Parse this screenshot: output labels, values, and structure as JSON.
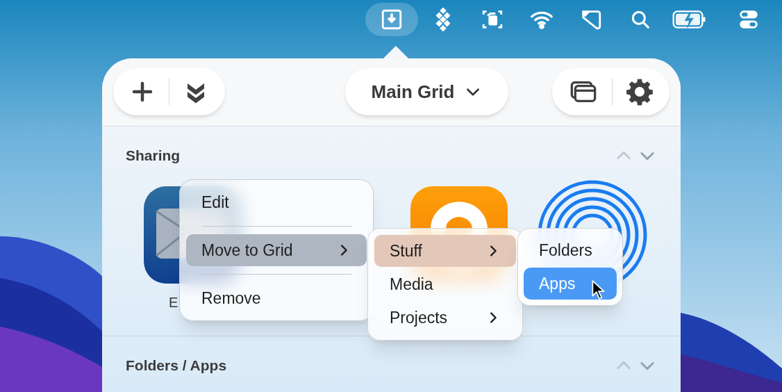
{
  "menu_bar": [
    {
      "kind": "download",
      "selected": true
    },
    {
      "kind": "diamonds",
      "selected": false
    },
    {
      "kind": "capture",
      "selected": false
    },
    {
      "kind": "wifi",
      "selected": false
    },
    {
      "kind": "shape",
      "selected": false
    },
    {
      "kind": "search",
      "selected": false
    },
    {
      "kind": "battery",
      "selected": false
    },
    {
      "kind": "toggles",
      "selected": false
    }
  ],
  "toolbar": {
    "grid_title": "Main Grid"
  },
  "sections": [
    {
      "title": "Sharing",
      "apps": [
        {
          "kind": "mail",
          "label": "E"
        },
        {
          "kind": "hidden"
        },
        {
          "kind": "orange"
        },
        {
          "kind": "rings"
        }
      ]
    },
    {
      "title": "Folders / Apps"
    }
  ],
  "context_menu": [
    {
      "label": "Edit",
      "submenu": false,
      "selected": false
    },
    {
      "label": "Move to Grid",
      "submenu": true,
      "selected": true
    },
    {
      "label": "Remove",
      "submenu": false,
      "selected": false
    }
  ],
  "grid_submenu": [
    {
      "label": "Stuff",
      "submenu": true,
      "selected": true
    },
    {
      "label": "Media",
      "submenu": false,
      "selected": false
    },
    {
      "label": "Projects",
      "submenu": true,
      "selected": false
    }
  ],
  "stuff_submenu": [
    {
      "label": "Folders",
      "selected": false
    },
    {
      "label": "Apps",
      "selected": true
    }
  ]
}
